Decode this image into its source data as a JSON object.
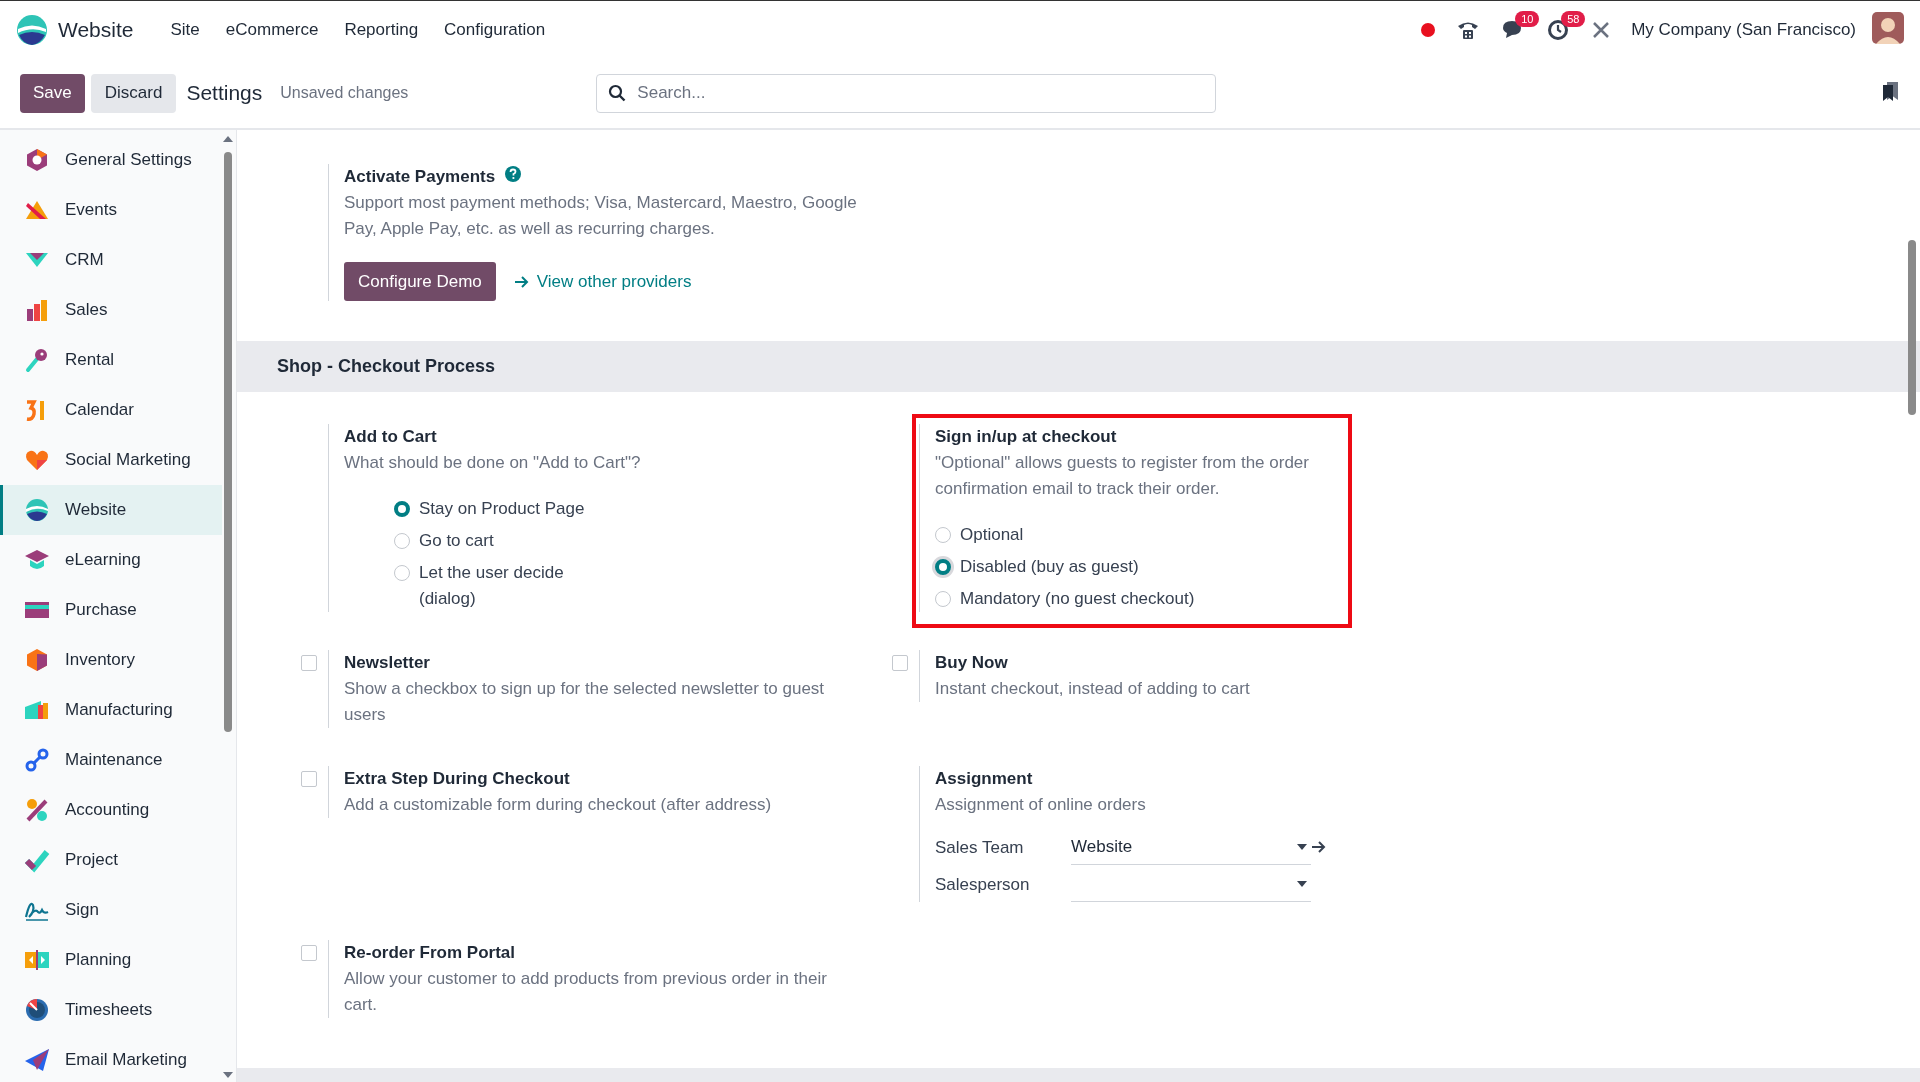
{
  "app": {
    "name": "Website"
  },
  "menu": [
    "Site",
    "eCommerce",
    "Reporting",
    "Configuration"
  ],
  "systray": {
    "chat_count": "10",
    "activity_count": "58",
    "company": "My Company (San Francisco)"
  },
  "control_panel": {
    "save": "Save",
    "discard": "Discard",
    "title": "Settings",
    "status": "Unsaved changes",
    "search": {
      "placeholder": "Search..."
    }
  },
  "sidebar": {
    "items": [
      {
        "label": "General Settings",
        "selected": false
      },
      {
        "label": "Events",
        "selected": false
      },
      {
        "label": "CRM",
        "selected": false
      },
      {
        "label": "Sales",
        "selected": false
      },
      {
        "label": "Rental",
        "selected": false
      },
      {
        "label": "Calendar",
        "selected": false
      },
      {
        "label": "Social Marketing",
        "selected": false
      },
      {
        "label": "Website",
        "selected": true
      },
      {
        "label": "eLearning",
        "selected": false
      },
      {
        "label": "Purchase",
        "selected": false
      },
      {
        "label": "Inventory",
        "selected": false
      },
      {
        "label": "Manufacturing",
        "selected": false
      },
      {
        "label": "Maintenance",
        "selected": false
      },
      {
        "label": "Accounting",
        "selected": false
      },
      {
        "label": "Project",
        "selected": false
      },
      {
        "label": "Sign",
        "selected": false
      },
      {
        "label": "Planning",
        "selected": false
      },
      {
        "label": "Timesheets",
        "selected": false
      },
      {
        "label": "Email Marketing",
        "selected": false
      }
    ]
  },
  "payments": {
    "title": "Activate Payments",
    "description": "Support most payment methods; Visa, Mastercard, Maestro, Google Pay, Apple Pay, etc. as well as recurring charges.",
    "button": "Configure Demo",
    "link": "View other providers"
  },
  "section": {
    "title": "Shop - Checkout Process",
    "settings": [
      {
        "kind": "radio",
        "title": "Add to Cart",
        "description": "What should be done on \"Add to Cart\"?",
        "highlighted": false,
        "options": [
          {
            "label": "Stay on Product Page",
            "selected": true
          },
          {
            "label": "Go to cart",
            "selected": false
          },
          {
            "label": "Let the user decide (dialog)",
            "selected": false
          }
        ]
      },
      {
        "kind": "radio",
        "title": "Sign in/up at checkout",
        "description": "\"Optional\" allows guests to register from the order confirmation email to track their order.",
        "highlighted": true,
        "options": [
          {
            "label": "Optional",
            "selected": false
          },
          {
            "label": "Disabled (buy as guest)",
            "selected": true
          },
          {
            "label": "Mandatory (no guest checkout)",
            "selected": false
          }
        ]
      },
      {
        "kind": "checkbox",
        "title": "Newsletter",
        "description": "Show a checkbox to sign up for the selected newsletter to guest users",
        "checked": false
      },
      {
        "kind": "checkbox",
        "title": "Buy Now",
        "description": "Instant checkout, instead of adding to cart",
        "checked": false
      },
      {
        "kind": "checkbox",
        "title": "Extra Step During Checkout",
        "description": "Add a customizable form during checkout (after address)",
        "checked": false
      },
      {
        "kind": "fields",
        "title": "Assignment",
        "description": "Assignment of online orders",
        "fields": [
          {
            "label": "Sales Team",
            "value": "Website"
          },
          {
            "label": "Salesperson"
          }
        ]
      },
      {
        "kind": "checkbox",
        "title": "Re-order From Portal",
        "description": "Allow your customer to add products from previous order in their cart.",
        "checked": false
      }
    ]
  }
}
